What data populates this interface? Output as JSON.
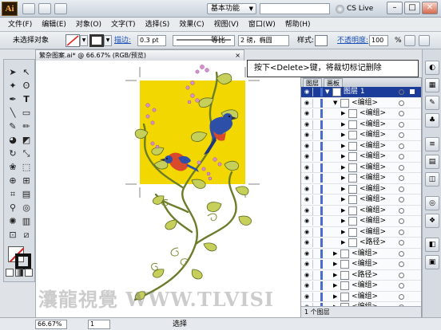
{
  "app": {
    "logo_text": "Ai",
    "workspace": "基本功能",
    "cs_live": "CS Live",
    "window_buttons": [
      "–",
      "□",
      "✕"
    ]
  },
  "menu": [
    "文件(F)",
    "编辑(E)",
    "对象(O)",
    "文字(T)",
    "选择(S)",
    "效果(C)",
    "视图(V)",
    "窗口(W)",
    "帮助(H)"
  ],
  "controlbar": {
    "selection_label": "未选择对象",
    "stroke_label": "描边:",
    "stroke_weight": "0.3 pt",
    "brush_label": "等比",
    "profile_label": "2 磅，椭圆",
    "style_label": "样式:",
    "opacity_label": "不透明度:",
    "opacity_value": "100",
    "opacity_unit": "%"
  },
  "document": {
    "tab_title": "繁杂图案.ai* @ 66.67% (RGB/预览)",
    "close": "×"
  },
  "callout": "按下<Delete>键，将裁切标记删除",
  "layers_panel": {
    "tabs": [
      "图层",
      "画板"
    ],
    "rows": [
      {
        "name": "图层 1",
        "level": 0,
        "expanded": true,
        "selected": true
      },
      {
        "name": "<编组>",
        "level": 1,
        "expanded": true
      },
      {
        "name": "<编组>",
        "level": 2
      },
      {
        "name": "<编组>",
        "level": 2
      },
      {
        "name": "<编组>",
        "level": 2
      },
      {
        "name": "<编组>",
        "level": 2
      },
      {
        "name": "<编组>",
        "level": 2
      },
      {
        "name": "<编组>",
        "level": 2
      },
      {
        "name": "<编组>",
        "level": 2
      },
      {
        "name": "<编组>",
        "level": 2
      },
      {
        "name": "<编组>",
        "level": 2
      },
      {
        "name": "<编组>",
        "level": 2
      },
      {
        "name": "<编组>",
        "level": 2
      },
      {
        "name": "<编组>",
        "level": 2
      },
      {
        "name": "<路径>",
        "level": 2
      },
      {
        "name": "<编组>",
        "level": 1
      },
      {
        "name": "<编组>",
        "level": 1
      },
      {
        "name": "<路径>",
        "level": 1
      },
      {
        "name": "<编组>",
        "level": 1
      },
      {
        "name": "<编组>",
        "level": 1
      },
      {
        "name": "<编组>",
        "level": 1
      },
      {
        "name": "<编组>",
        "level": 1
      }
    ],
    "footer": "1 个图层"
  },
  "status": {
    "zoom": "66.67%",
    "page": "1",
    "tool": "选择"
  },
  "watermark": "灢龍視覺 WWW.TLVISI"
}
